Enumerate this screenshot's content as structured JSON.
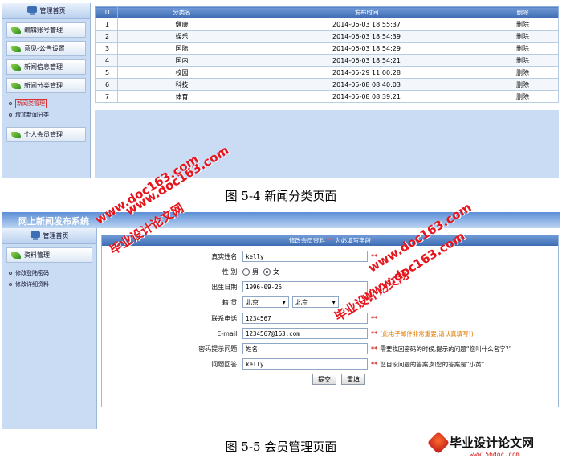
{
  "screen1": {
    "sidebar": {
      "header": "管理首页",
      "buttons": [
        "编辑账号管理",
        "意见-公告设置",
        "新闻信息管理",
        "新闻分类管理"
      ],
      "sub_items": [
        "新闻类管理",
        "增加新闻分类"
      ],
      "bottom_button": "个人会员管理"
    },
    "table": {
      "columns": [
        "ID",
        "分类名",
        "发布时间",
        "删除"
      ],
      "rows": [
        [
          "1",
          "健康",
          "2014-06-03 18:55:37",
          "删除"
        ],
        [
          "2",
          "娱乐",
          "2014-06-03 18:54:39",
          "删除"
        ],
        [
          "3",
          "国际",
          "2014-06-03 18:54:29",
          "删除"
        ],
        [
          "4",
          "国内",
          "2014-06-03 18:54:21",
          "删除"
        ],
        [
          "5",
          "校园",
          "2014-05-29 11:00:28",
          "删除"
        ],
        [
          "6",
          "科技",
          "2014-05-08 08:40:03",
          "删除"
        ],
        [
          "7",
          "体育",
          "2014-05-08 08:39:21",
          "删除"
        ]
      ]
    }
  },
  "caption1": "图 5-4 新闻分类页面",
  "screen2": {
    "title": "网上新闻发布系统",
    "sidebar": {
      "header": "管理首页",
      "button": "资料管理",
      "sub_items": [
        "修改登陆密码",
        "修改详细资料"
      ]
    },
    "form_header": {
      "text": "修改会员资料",
      "required_mark": "**",
      "suffix": "为必填写字段"
    },
    "form": {
      "name_label": "真实姓名:",
      "name_value": "kelly",
      "gender_label": "性    别:",
      "gender_male": "男",
      "gender_female": "女",
      "birth_label": "出生日期:",
      "birth_value": "1996-09-25",
      "origin_label": "籍    贯:",
      "province": "北京",
      "city": "北京",
      "phone_label": "联系电话:",
      "phone_value": "1234567",
      "email_label": "E-mail:",
      "email_value": "1234567@163.com",
      "email_hint": "(此电子邮件非常重要,请认真填写!)",
      "question_label": "密码提示问题:",
      "question_value": "姓名",
      "question_hint": "需要找回密码的时候,提示的问题“您叫什么名字?”",
      "answer_label": "问题回答:",
      "answer_value": "kelly",
      "answer_hint": "您自设问题的答案,如您的答案是“小黄”",
      "star": "**",
      "submit_label": "提交",
      "reset_label": "重填"
    }
  },
  "caption2": "图 5-5 会员管理页面",
  "watermarks": {
    "url1": "www.doc163.com",
    "site": "毕业设计论文网",
    "logo_text": "毕业设计论文网",
    "logo_url": "www.56doc.com"
  },
  "colors": {
    "header_blue": "#3f6db3",
    "sidebar_bg": "#c9dcf3",
    "required_red": "#d02020",
    "watermark_red": "#e8141c"
  }
}
